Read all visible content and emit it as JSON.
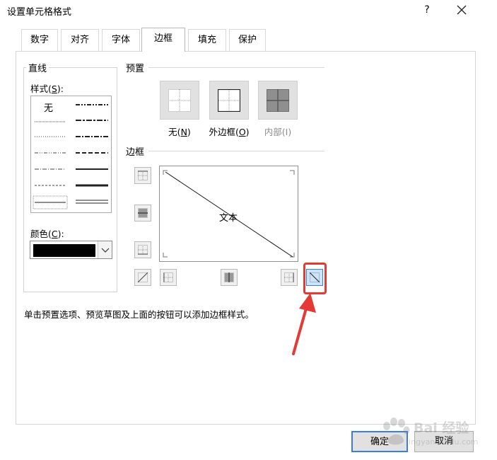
{
  "window": {
    "title": "设置单元格格式",
    "help_label": "?"
  },
  "tabs": [
    {
      "label": "数字"
    },
    {
      "label": "对齐"
    },
    {
      "label": "字体"
    },
    {
      "label": "边框",
      "active": true
    },
    {
      "label": "填充"
    },
    {
      "label": "保护"
    }
  ],
  "line_group": {
    "title": "直线",
    "style_label_prefix": "样式(",
    "style_label_key": "S",
    "style_label_suffix": "):",
    "style_none_text": "无",
    "color_label_prefix": "颜色(",
    "color_label_key": "C",
    "color_label_suffix": "):",
    "color_value": "#000000"
  },
  "presets": {
    "title": "预置",
    "items": [
      {
        "label": "无(N)",
        "prefix": "无(",
        "key": "N",
        "suffix": ")",
        "icon": "preset-none-icon"
      },
      {
        "label": "外边框(O)",
        "prefix": "外边框(",
        "key": "O",
        "suffix": ")",
        "icon": "preset-outline-icon"
      },
      {
        "label": "内部(I)",
        "prefix": "内部(I)",
        "key": "",
        "suffix": "",
        "icon": "preset-inside-icon",
        "disabled": true
      }
    ]
  },
  "border": {
    "title": "边框",
    "preview_text": "文本"
  },
  "hint": "单击预置选项、预览草图及上面的按钮可以添加边框样式。",
  "footer": {
    "ok_label": "确定",
    "cancel_label": "取消"
  },
  "watermark": {
    "main": "Bai 经验",
    "sub": "jingyan.baidu.com"
  },
  "colors": {
    "accent": "#3c7fd6",
    "highlight": "#e53935",
    "disabled_text": "#8c8c8c"
  }
}
